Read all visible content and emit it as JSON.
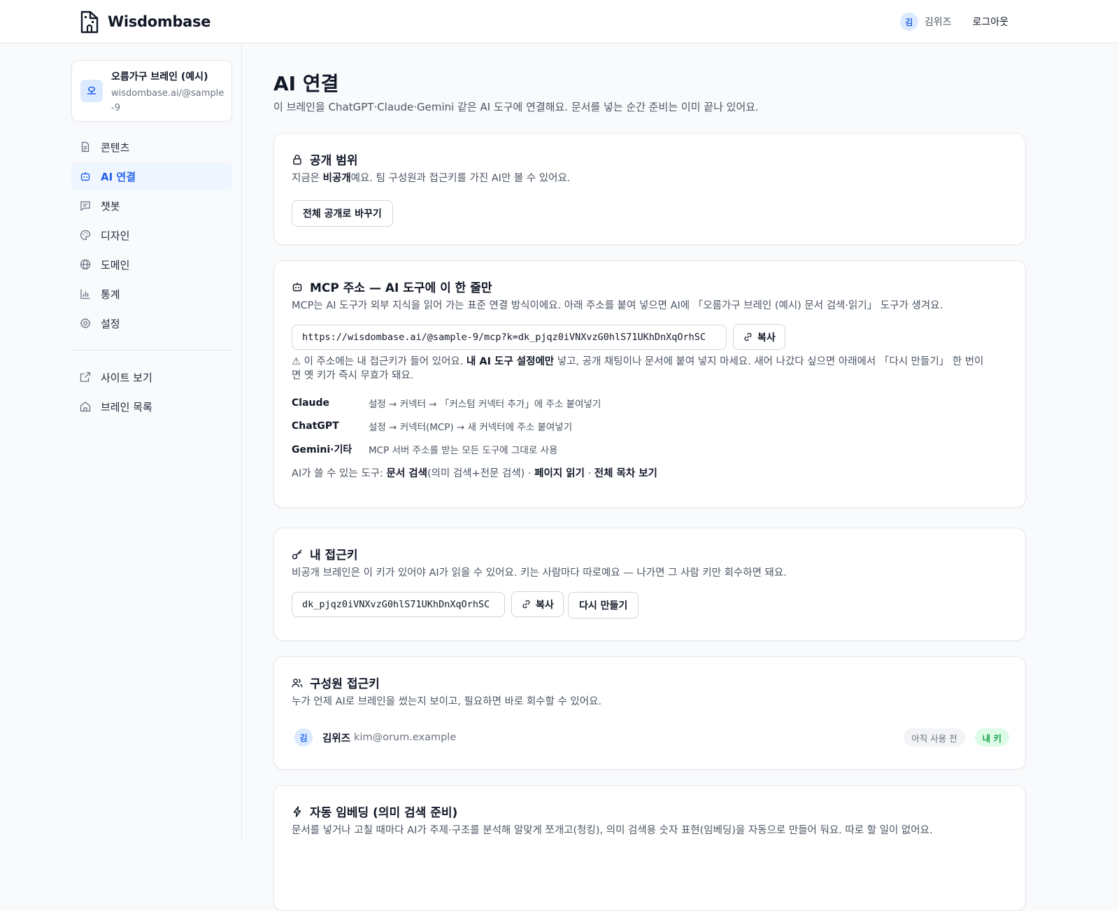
{
  "header": {
    "brand": "Wisdombase",
    "user_initial": "김",
    "user_name": "김위즈",
    "logout_label": "로그아웃"
  },
  "sidebar": {
    "brain": {
      "initial": "오",
      "name": "오름가구 브레인 (예시)",
      "url": "wisdombase.ai/@sample-9"
    },
    "items": [
      {
        "label": "콘텐츠",
        "icon": "document-icon"
      },
      {
        "label": "AI 연결",
        "icon": "robot-icon",
        "active": true
      },
      {
        "label": "챗봇",
        "icon": "chat-icon"
      },
      {
        "label": "디자인",
        "icon": "palette-icon"
      },
      {
        "label": "도메인",
        "icon": "globe-icon"
      },
      {
        "label": "통계",
        "icon": "bar-chart-icon"
      },
      {
        "label": "설정",
        "icon": "gear-icon"
      }
    ],
    "links": [
      {
        "label": "사이트 보기",
        "icon": "external-link-icon"
      },
      {
        "label": "브레인 목록",
        "icon": "home-icon"
      }
    ]
  },
  "main": {
    "title": "AI 연결",
    "description": "이 브레인을 ChatGPT·Claude·Gemini 같은 AI 도구에 연결해요. 문서를 넣는 순간 준비는 이미 끝나 있어요.",
    "visibility": {
      "title": "공개 범위",
      "desc_before": "지금은 ",
      "desc_bold": "비공개",
      "desc_after": "예요. 팀 구성원과 접근키를 가진 AI만 볼 수 있어요.",
      "button": "전체 공개로 바꾸기"
    },
    "mcp": {
      "title": "MCP 주소 — AI 도구에 이 한 줄만",
      "desc": "MCP는 AI 도구가 외부 지식을 읽어 가는 표준 연결 방식이에요. 아래 주소를 붙여 넣으면 AI에 「오름가구 브레인 (예시) 문서 검색·읽기」 도구가 생겨요.",
      "url": "https://wisdombase.ai/@sample-9/mcp?k=dk_pjqz0iVNXvzG0hlS71UKhDnXqOrhSC",
      "copy_label": "복사",
      "warn_before": "⚠ 이 주소에는 내 접근키가 들어 있어요. ",
      "warn_bold": "내 AI 도구 설정에만",
      "warn_after": " 넣고, 공개 채팅이나 문서에 붙여 넣지 마세요. 새어 나갔다 싶으면 아래에서 「다시 만들기」 한 번이면 옛 키가 즉시 무효가 돼요.",
      "tools": [
        {
          "name": "Claude",
          "desc": "설정 → 커넥터 → 「커스텀 커넥터 추가」에 주소 붙여넣기"
        },
        {
          "name": "ChatGPT",
          "desc": "설정 → 커넥터(MCP) → 새 커넥터에 주소 붙여넣기"
        },
        {
          "name": "Gemini·기타",
          "desc": "MCP 서버 주소를 받는 모든 도구에 그대로 사용"
        }
      ],
      "available_prefix": "AI가 쓸 수 있는 도구: ",
      "available_1": "문서 검색",
      "available_1_note": "(의미 검색+전문 검색)",
      "sep": " · ",
      "available_2": "페이지 읽기",
      "available_3": "전체 목차 보기"
    },
    "key": {
      "title": "내 접근키",
      "desc": "비공개 브레인은 이 키가 있어야 AI가 읽을 수 있어요. 키는 사람마다 따로예요 — 나가면 그 사람 키만 회수하면 돼요.",
      "value": "dk_pjqz0iVNXvzG0hlS71UKhDnXqOrhSC",
      "copy_label": "복사",
      "regen_label": "다시 만들기"
    },
    "members": {
      "title": "구성원 접근키",
      "desc": "누가 언제 AI로 브레인을 썼는지 보이고, 필요하면 바로 회수할 수 있어요.",
      "list": [
        {
          "initial": "김",
          "name": "김위즈",
          "email": "kim@orum.example",
          "status": "아직 사용 전",
          "tag": "내 키"
        }
      ]
    },
    "embedding": {
      "title": "자동 임베딩 (의미 검색 준비)",
      "desc": "문서를 넣거나 고칠 때마다 AI가 주제·구조를 분석해 알맞게 쪼개고(청킹), 의미 검색용 숫자 표현(임베딩)을 자동으로 만들어 둬요. 따로 할 일이 없어요."
    }
  },
  "colors": {
    "accent": "#2563eb",
    "accent_bg": "#eff6ff",
    "success": "#16a34a"
  }
}
